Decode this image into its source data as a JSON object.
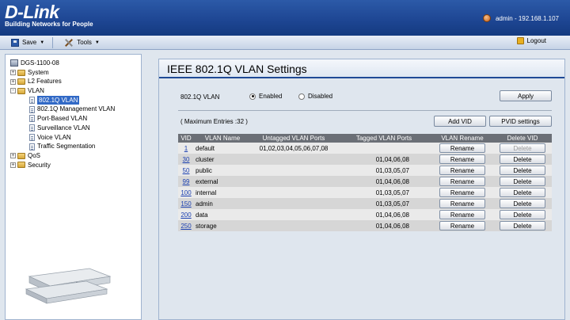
{
  "header": {
    "brand": "D-Link",
    "tagline": "Building Networks for People",
    "user_info": "admin - 192.168.1.107"
  },
  "toolbar": {
    "save_label": "Save",
    "tools_label": "Tools",
    "logout_label": "Logout"
  },
  "tree": {
    "root": "DGS-1100-08",
    "items": [
      {
        "label": "System",
        "indent": 0,
        "type": "folder",
        "exp": "+"
      },
      {
        "label": "L2 Features",
        "indent": 0,
        "type": "folder",
        "exp": "+"
      },
      {
        "label": "VLAN",
        "indent": 0,
        "type": "folder",
        "exp": "-"
      },
      {
        "label": "802.1Q VLAN",
        "indent": 1,
        "type": "page",
        "selected": true
      },
      {
        "label": "802.1Q Management VLAN",
        "indent": 1,
        "type": "page"
      },
      {
        "label": "Port-Based VLAN",
        "indent": 1,
        "type": "page"
      },
      {
        "label": "Surveillance VLAN",
        "indent": 1,
        "type": "page"
      },
      {
        "label": "Voice VLAN",
        "indent": 1,
        "type": "page"
      },
      {
        "label": "Traffic Segmentation",
        "indent": 1,
        "type": "page"
      },
      {
        "label": "QoS",
        "indent": 0,
        "type": "folder",
        "exp": "+"
      },
      {
        "label": "Security",
        "indent": 0,
        "type": "folder",
        "exp": "+"
      }
    ]
  },
  "main": {
    "title": "IEEE 802.1Q VLAN Settings",
    "vlan_label": "802.1Q VLAN",
    "enabled_label": "Enabled",
    "disabled_label": "Disabled",
    "apply_label": "Apply",
    "max_entries": "( Maximum Entries :32 )",
    "add_vid_label": "Add VID",
    "pvid_label": "PVID settings",
    "columns": [
      "VID",
      "VLAN Name",
      "Untagged VLAN Ports",
      "Tagged VLAN Ports",
      "VLAN Rename",
      "Delete VID"
    ],
    "rename_label": "Rename",
    "delete_label": "Delete",
    "rows": [
      {
        "vid": "1",
        "name": "default",
        "untagged": "01,02,03,04,05,06,07,08",
        "tagged": "",
        "delete_disabled": true
      },
      {
        "vid": "30",
        "name": "cluster",
        "untagged": "",
        "tagged": "01,04,06,08",
        "delete_disabled": false
      },
      {
        "vid": "50",
        "name": "public",
        "untagged": "",
        "tagged": "01,03,05,07",
        "delete_disabled": false
      },
      {
        "vid": "99",
        "name": "external",
        "untagged": "",
        "tagged": "01,04,06,08",
        "delete_disabled": false
      },
      {
        "vid": "100",
        "name": "internal",
        "untagged": "",
        "tagged": "01,03,05,07",
        "delete_disabled": false
      },
      {
        "vid": "150",
        "name": "admin",
        "untagged": "",
        "tagged": "01,03,05,07",
        "delete_disabled": false
      },
      {
        "vid": "200",
        "name": "data",
        "untagged": "",
        "tagged": "01,04,06,08",
        "delete_disabled": false
      },
      {
        "vid": "250",
        "name": "storage",
        "untagged": "",
        "tagged": "01,04,06,08",
        "delete_disabled": false
      }
    ]
  }
}
